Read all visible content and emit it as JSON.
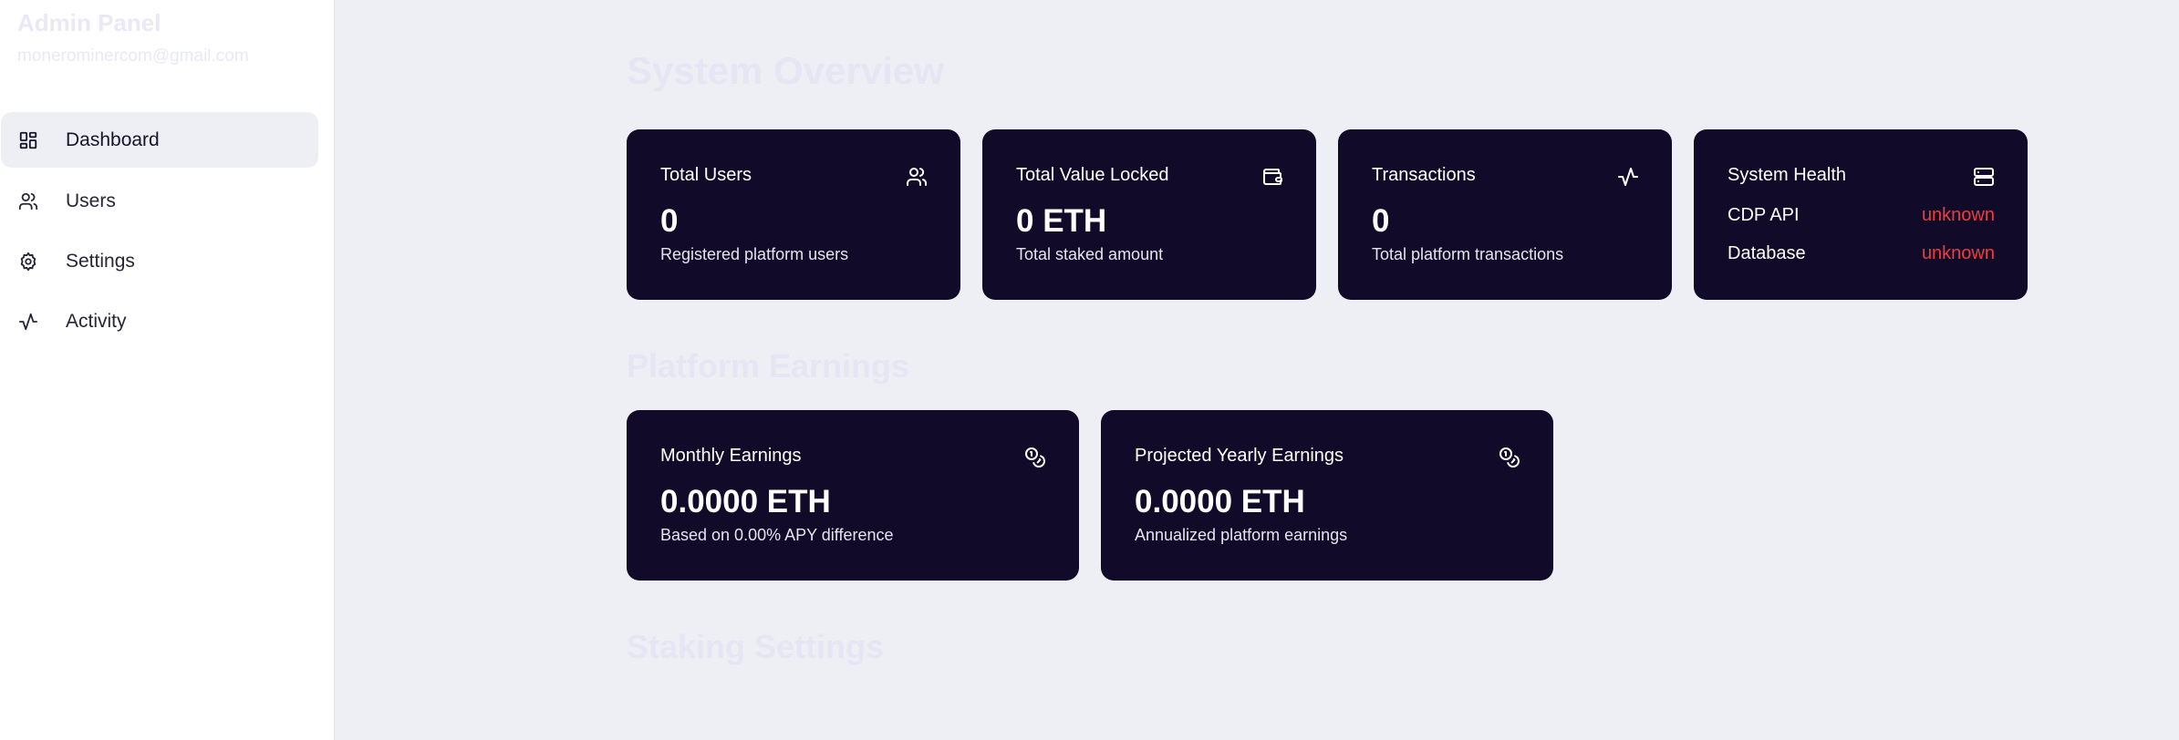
{
  "sidebar": {
    "title": "Admin Panel",
    "email": "monerominercom@gmail.com",
    "items": [
      {
        "label": "Dashboard",
        "icon": "dashboard-icon",
        "active": true
      },
      {
        "label": "Users",
        "icon": "users-icon",
        "active": false
      },
      {
        "label": "Settings",
        "icon": "gear-icon",
        "active": false
      },
      {
        "label": "Activity",
        "icon": "activity-icon",
        "active": false
      }
    ]
  },
  "overview": {
    "title": "System Overview",
    "total_users": {
      "title": "Total Users",
      "value": "0",
      "sub": "Registered platform users",
      "icon": "users-icon"
    },
    "tvl": {
      "title": "Total Value Locked",
      "value": "0 ETH",
      "sub": "Total staked amount",
      "icon": "wallet-icon"
    },
    "transactions": {
      "title": "Transactions",
      "value": "0",
      "sub": "Total platform transactions",
      "icon": "activity-icon"
    },
    "health": {
      "title": "System Health",
      "icon": "server-icon",
      "rows": [
        {
          "label": "CDP API",
          "status": "unknown"
        },
        {
          "label": "Database",
          "status": "unknown"
        }
      ]
    }
  },
  "earnings": {
    "title": "Platform Earnings",
    "monthly": {
      "title": "Monthly Earnings",
      "value": "0.0000 ETH",
      "sub": "Based on 0.00% APY difference",
      "icon": "coins-icon"
    },
    "yearly": {
      "title": "Projected Yearly Earnings",
      "value": "0.0000 ETH",
      "sub": "Annualized platform earnings",
      "icon": "coins-icon"
    }
  },
  "staking": {
    "title": "Staking Settings"
  },
  "colors": {
    "card_bg": "#110a28",
    "page_bg": "#eeeff4",
    "status_unknown": "#ef3d3d"
  }
}
